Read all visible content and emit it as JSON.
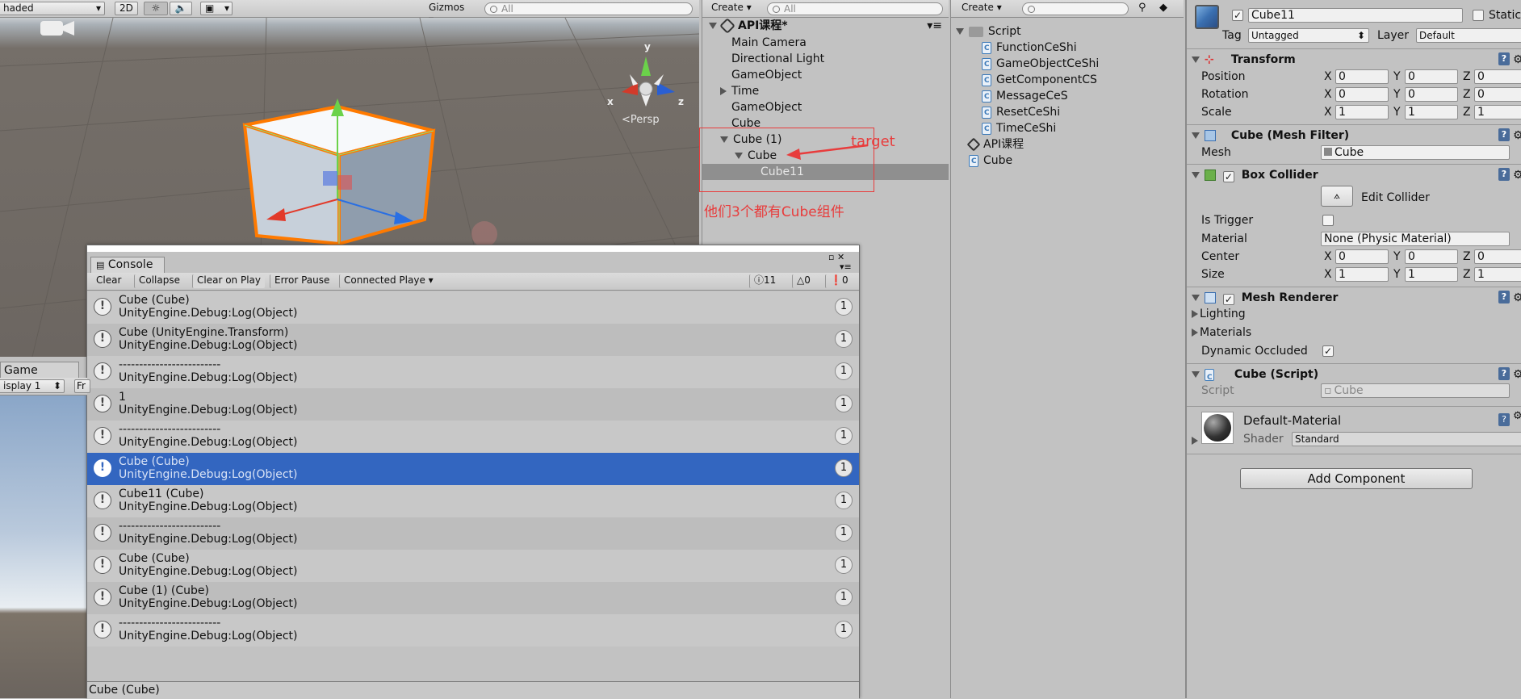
{
  "scene": {
    "shading": "haded",
    "mode2d": "2D",
    "gizmos": "Gizmos",
    "search_placeholder": "All",
    "persp": "Persp",
    "axis_x": "x",
    "axis_y": "y",
    "axis_z": "z"
  },
  "game": {
    "tab": "Game",
    "display": "isplay 1",
    "fr": "Fr"
  },
  "hierarchy": {
    "create": "Create",
    "search_placeholder": "All",
    "scene_name": "API课程*",
    "items": [
      "Main Camera",
      "Directional Light",
      "GameObject",
      "Time",
      "GameObject",
      "Cube",
      "Cube (1)",
      "Cube",
      "Cube11"
    ],
    "annotation_target": "target",
    "annotation_note": "他们3个都有Cube组件"
  },
  "project": {
    "create": "Create",
    "folder": "Script",
    "scripts": [
      "FunctionCeShi",
      "GameObjectCeShi",
      "GetComponentCS",
      "MessageCeS",
      "ResetCeShi",
      "TimeCeShi"
    ],
    "scene_asset": "API课程",
    "cube_asset": "Cube"
  },
  "inspector": {
    "name": "Cube11",
    "static": "Static",
    "tag_label": "Tag",
    "tag": "Untagged",
    "layer_label": "Layer",
    "layer": "Default",
    "transform": {
      "title": "Transform",
      "position_label": "Position",
      "rotation_label": "Rotation",
      "scale_label": "Scale",
      "x": "X",
      "y": "Y",
      "z": "Z",
      "position": [
        "0",
        "0",
        "0"
      ],
      "rotation": [
        "0",
        "0",
        "0"
      ],
      "scale": [
        "1",
        "1",
        "1"
      ]
    },
    "mesh_filter": {
      "title": "Cube (Mesh Filter)",
      "mesh_label": "Mesh",
      "mesh": "Cube"
    },
    "box_collider": {
      "title": "Box Collider",
      "edit": "Edit Collider",
      "is_trigger": "Is Trigger",
      "material_label": "Material",
      "material": "None (Physic Material)",
      "center_label": "Center",
      "size_label": "Size",
      "center": [
        "0",
        "0",
        "0"
      ],
      "size": [
        "1",
        "1",
        "1"
      ]
    },
    "mesh_renderer": {
      "title": "Mesh Renderer",
      "lighting": "Lighting",
      "materials": "Materials",
      "dynamic_occluded": "Dynamic Occluded"
    },
    "cube_script": {
      "title": "Cube (Script)",
      "script_label": "Script",
      "script": "Cube"
    },
    "material": {
      "name": "Default-Material",
      "shader_label": "Shader",
      "shader": "Standard"
    },
    "add_component": "Add Component"
  },
  "console": {
    "title": "Console",
    "buttons": {
      "clear": "Clear",
      "collapse": "Collapse",
      "clear_on_play": "Clear on Play",
      "error_pause": "Error Pause",
      "connected": "Connected Playe"
    },
    "counts": {
      "log": "11",
      "warn": "0",
      "error": "0"
    },
    "rows": [
      {
        "l1": "Cube (Cube)",
        "l2": "UnityEngine.Debug:Log(Object)",
        "count": "1"
      },
      {
        "l1": "Cube (UnityEngine.Transform)",
        "l2": "UnityEngine.Debug:Log(Object)",
        "count": "1"
      },
      {
        "l1": "-------------------------",
        "l2": "UnityEngine.Debug:Log(Object)",
        "count": "1"
      },
      {
        "l1": "1",
        "l2": "UnityEngine.Debug:Log(Object)",
        "count": "1"
      },
      {
        "l1": "-------------------------",
        "l2": "UnityEngine.Debug:Log(Object)",
        "count": "1"
      },
      {
        "l1": "Cube (Cube)",
        "l2": "UnityEngine.Debug:Log(Object)",
        "count": "1"
      },
      {
        "l1": "Cube11 (Cube)",
        "l2": "UnityEngine.Debug:Log(Object)",
        "count": "1"
      },
      {
        "l1": "-------------------------",
        "l2": "UnityEngine.Debug:Log(Object)",
        "count": "1"
      },
      {
        "l1": "Cube (Cube)",
        "l2": "UnityEngine.Debug:Log(Object)",
        "count": "1"
      },
      {
        "l1": "Cube (1) (Cube)",
        "l2": "UnityEngine.Debug:Log(Object)",
        "count": "1"
      },
      {
        "l1": "-------------------------",
        "l2": "UnityEngine.Debug:Log(Object)",
        "count": "1"
      }
    ],
    "detail": "Cube (Cube)"
  }
}
